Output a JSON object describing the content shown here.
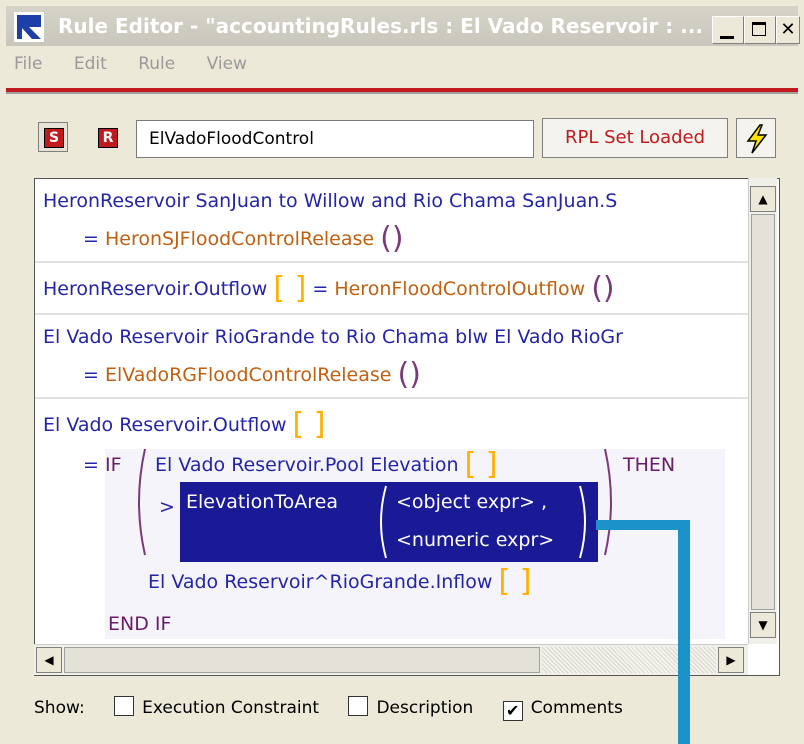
{
  "window": {
    "title": "Rule Editor - \"accountingRules.rls : El Vado Reservoir : ...",
    "min_label": "_",
    "max_label": "□",
    "close_label": "✕"
  },
  "menu": [
    "File",
    "Edit",
    "Rule",
    "View"
  ],
  "toolbar": {
    "s_label": "S",
    "r_label": "R",
    "rule_name": "ElVadoFloodControl",
    "rpl_button": "RPL Set Loaded"
  },
  "editor": {
    "lines": [
      {
        "text": "HeronReservoir SanJuan to Willow and Rio Chama SanJuan.S"
      },
      {
        "eq": "=",
        "fn": "HeronSJFloodControlRelease"
      },
      {
        "obj": "HeronReservoir.Outflow",
        "eq": "=",
        "fn": "HeronFloodControlOutflow"
      },
      {
        "text": "El Vado Reservoir RioGrande to Rio Chama blw El Vado RioGr"
      },
      {
        "eq": "=",
        "fn": "ElVadoRGFloodControlRelease"
      },
      {
        "obj": "El Vado Reservoir.Outflow"
      },
      {
        "eq": "=",
        "kw_if": "IF",
        "cond": "El Vado Reservoir.Pool Elevation",
        "kw_then": "THEN"
      },
      {
        "op": ">",
        "fn": "ElevationToArea",
        "arg1": "<object expr> ,",
        "arg2": "<numeric expr>"
      },
      {
        "obj": "El Vado Reservoir^RioGrande.Inflow"
      },
      {
        "kw": "END IF"
      }
    ]
  },
  "show": {
    "label": "Show:",
    "options": [
      {
        "label": "Execution Constraint",
        "checked": false
      },
      {
        "label": "Description",
        "checked": false
      },
      {
        "label": "Comments",
        "checked": true
      }
    ]
  },
  "colors": {
    "selection": "#1a1a96",
    "annotation": "#1b93c9",
    "rpl_text": "#c0191e"
  }
}
